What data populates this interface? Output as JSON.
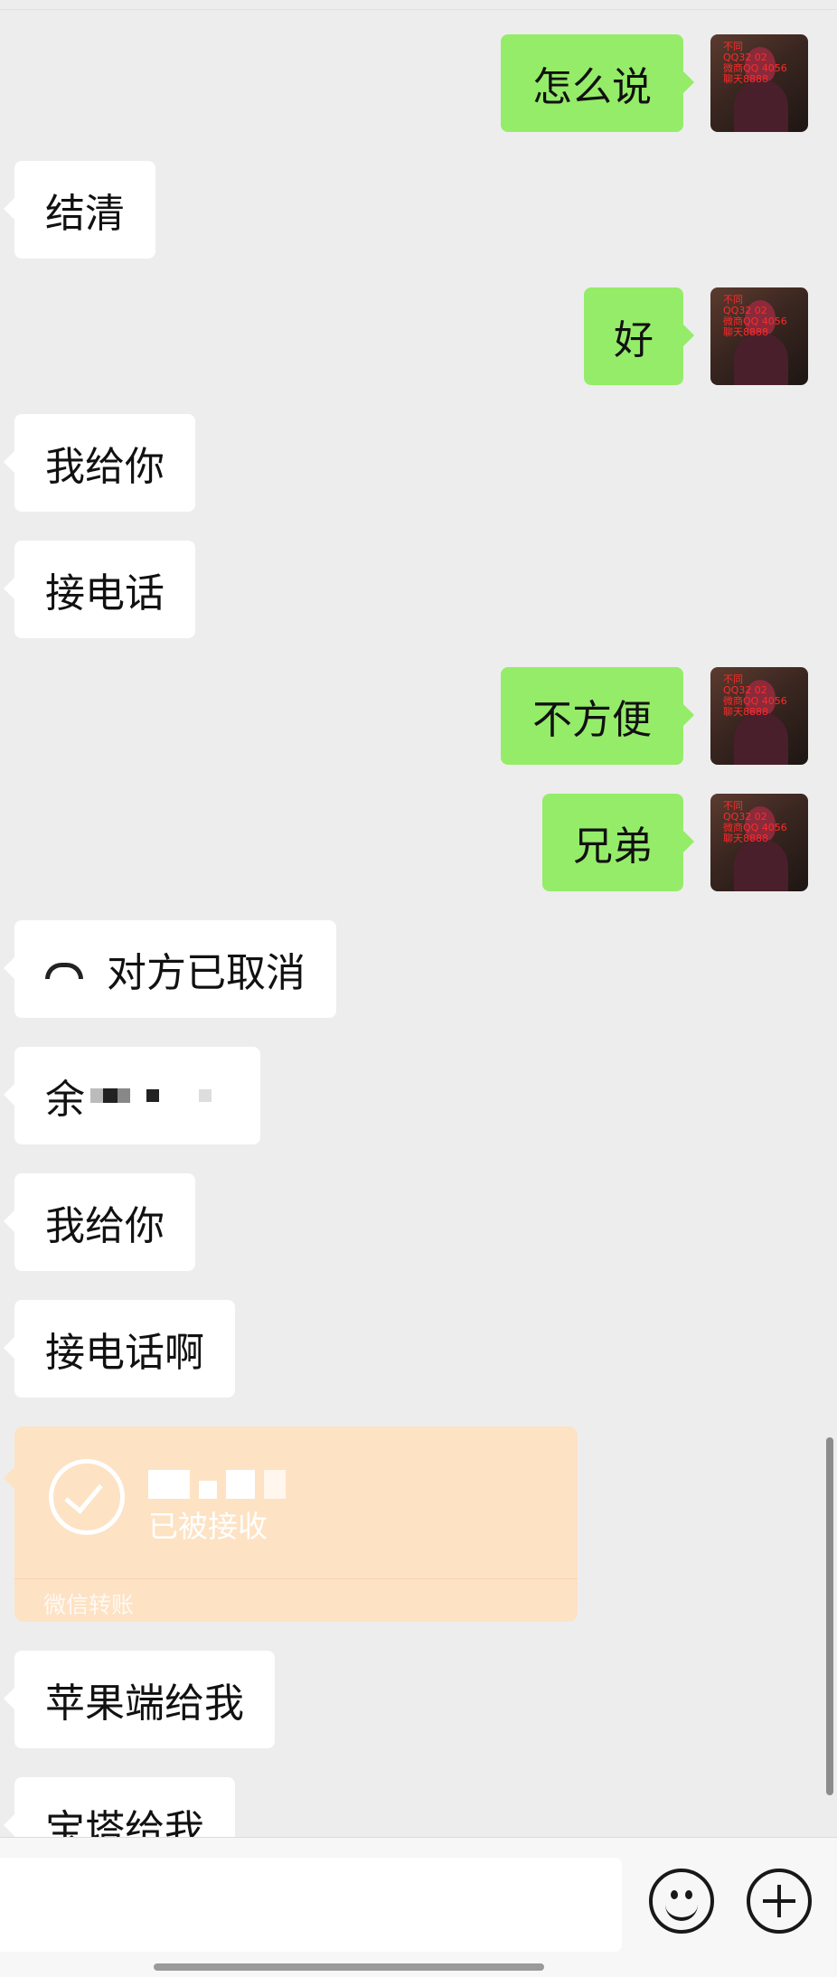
{
  "messages": {
    "m1_out": "怎么说",
    "m2_in": "结清",
    "m3_out": "好",
    "m4_in": "我给你",
    "m5_in": "接电话",
    "m6_out": "不方便",
    "m7_out": "兄弟",
    "m8_in_call": "对方已取消",
    "m9_in": "余",
    "m10_in": "我给你",
    "m11_in": "接电话啊",
    "m13_in": "苹果端给我",
    "m14_in": "宝塔给我"
  },
  "transfer": {
    "status": "已被接收",
    "footer": "微信转账"
  },
  "avatar": {
    "watermark": "不同 \nQQ32 02\n微商QQ 4056\n聊天8888"
  },
  "icons": {
    "call": "hangup-phone-icon",
    "emoji": "emoji-icon",
    "plus": "plus-icon",
    "check": "check-circle-icon"
  },
  "colors": {
    "background": "#ededed",
    "outgoing_bubble": "#95ec69",
    "incoming_bubble": "#ffffff",
    "transfer_card": "#fde2c4"
  }
}
